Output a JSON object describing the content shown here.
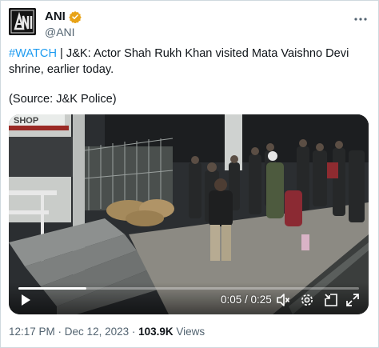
{
  "author": {
    "name": "ANI",
    "handle": "@ANI",
    "verified_color": "#e8a317",
    "avatar_text": "ANI"
  },
  "tweet": {
    "hashtag": "#WATCH",
    "body": " | J&K: Actor Shah Rukh Khan visited Mata Vaishno Devi shrine, earlier today.",
    "source_line": "(Source: J&K Police)",
    "hashtag_color": "#1d9bf0"
  },
  "video": {
    "sign_text": "SHOP",
    "time_display": "0:05 / 0:25",
    "progress": 0.2,
    "controls": [
      "play-icon",
      "volume-icon",
      "settings-icon",
      "pip-icon",
      "fullscreen-icon"
    ]
  },
  "footer": {
    "time": "12:17 PM",
    "separator": " · ",
    "date": "Dec 12, 2023",
    "views_count": "103.9K",
    "views_label": " Views"
  }
}
